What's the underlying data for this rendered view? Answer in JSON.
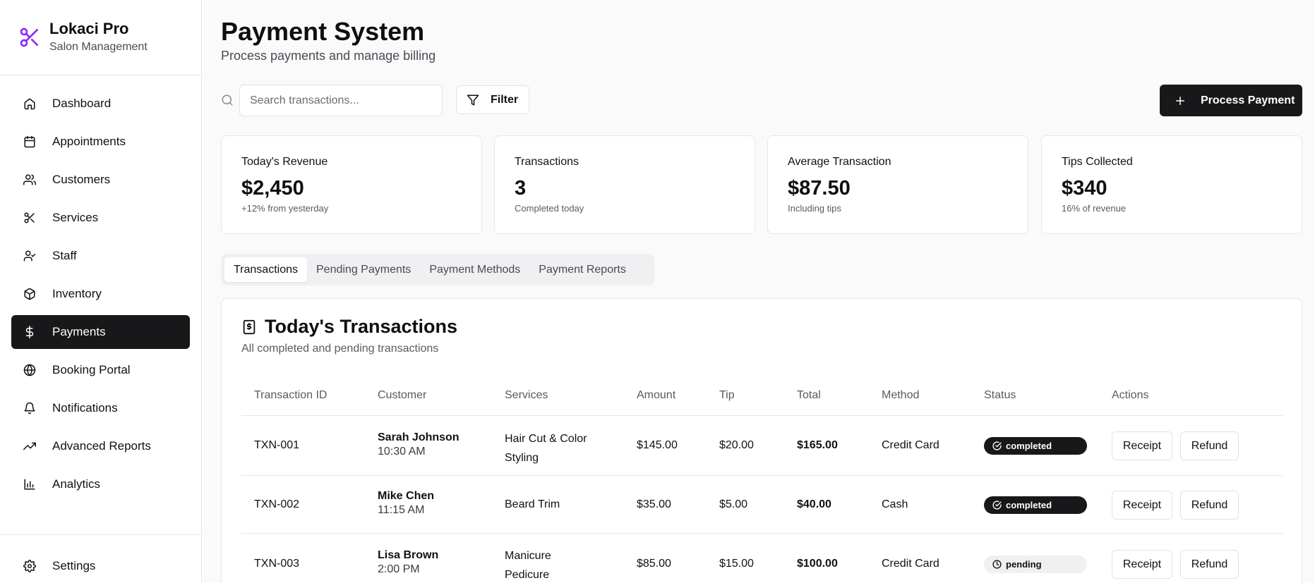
{
  "brand": {
    "name": "Lokaci Pro",
    "subtitle": "Salon Management",
    "icon": "scissors-icon",
    "accent": "#8b2cf5"
  },
  "sidebar": {
    "items": [
      {
        "label": "Dashboard",
        "icon": "home-icon"
      },
      {
        "label": "Appointments",
        "icon": "calendar-icon"
      },
      {
        "label": "Customers",
        "icon": "users-icon"
      },
      {
        "label": "Services",
        "icon": "scissors-icon"
      },
      {
        "label": "Staff",
        "icon": "user-check-icon"
      },
      {
        "label": "Inventory",
        "icon": "package-icon"
      },
      {
        "label": "Payments",
        "icon": "dollar-icon",
        "active": true
      },
      {
        "label": "Booking Portal",
        "icon": "globe-icon"
      },
      {
        "label": "Notifications",
        "icon": "bell-icon"
      },
      {
        "label": "Advanced Reports",
        "icon": "trending-up-icon"
      },
      {
        "label": "Analytics",
        "icon": "bar-chart-icon"
      }
    ],
    "settings": {
      "label": "Settings",
      "icon": "gear-icon"
    }
  },
  "header": {
    "title": "Payment System",
    "subtitle": "Process payments and manage billing"
  },
  "toolbar": {
    "search_placeholder": "Search transactions...",
    "filter_label": "Filter",
    "process_label": "Process Payment"
  },
  "stats": [
    {
      "label": "Today's Revenue",
      "value": "$2,450",
      "note": "+12% from yesterday"
    },
    {
      "label": "Transactions",
      "value": "3",
      "note": "Completed today"
    },
    {
      "label": "Average Transaction",
      "value": "$87.50",
      "note": "Including tips"
    },
    {
      "label": "Tips Collected",
      "value": "$340",
      "note": "16% of revenue"
    }
  ],
  "tabs": [
    "Transactions",
    "Pending Payments",
    "Payment Methods",
    "Payment Reports"
  ],
  "transactions": {
    "title": "Today's Transactions",
    "subtitle": "All completed and pending transactions",
    "columns": [
      "Transaction ID",
      "Customer",
      "Services",
      "Amount",
      "Tip",
      "Total",
      "Method",
      "Status",
      "Actions"
    ],
    "rows": [
      {
        "id": "TXN-001",
        "customer": "Sarah Johnson",
        "time": "10:30 AM",
        "services_1": "Hair Cut & Color",
        "services_2": "Styling",
        "amount": "$145.00",
        "tip": "$20.00",
        "total": "$165.00",
        "method": "Credit Card",
        "status": "completed"
      },
      {
        "id": "TXN-002",
        "customer": "Mike Chen",
        "time": "11:15 AM",
        "services_1": "Beard Trim",
        "services_2": "",
        "amount": "$35.00",
        "tip": "$5.00",
        "total": "$40.00",
        "method": "Cash",
        "status": "completed"
      },
      {
        "id": "TXN-003",
        "customer": "Lisa Brown",
        "time": "2:00 PM",
        "services_1": "Manicure",
        "services_2": "Pedicure",
        "amount": "$85.00",
        "tip": "$15.00",
        "total": "$100.00",
        "method": "Credit Card",
        "status": "pending"
      }
    ],
    "receipt_label": "Receipt",
    "refund_label": "Refund"
  }
}
